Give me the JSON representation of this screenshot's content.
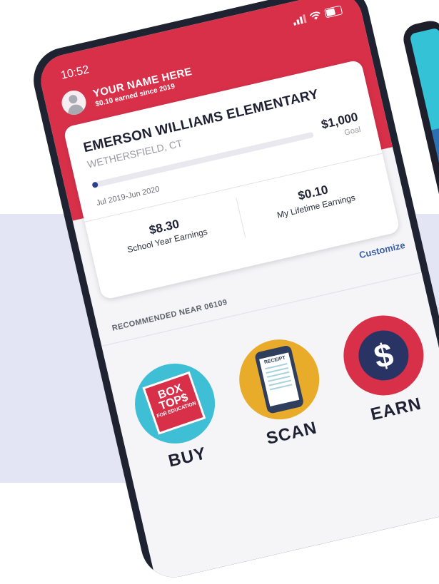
{
  "status_bar": {
    "time": "10:52"
  },
  "user": {
    "name": "YOUR NAME HERE",
    "subtitle": "$0.10 earned since 2019"
  },
  "school": {
    "name": "EMERSON WILLIAMS ELEMENTARY",
    "location": "WETHERSFIELD, CT",
    "goal_amount": "$1,000",
    "goal_label": "Goal",
    "progress_fraction": 0.01,
    "date_range": "Jul 2019-Jun 2020"
  },
  "stats": {
    "school_year": {
      "value": "$8.30",
      "label": "School Year Earnings"
    },
    "lifetime": {
      "value": "$0.10",
      "label": "My Lifetime Earnings"
    }
  },
  "customize_label": "Customize",
  "recommended_label": "RECOMMENDED NEAR 06109",
  "actions": {
    "buy": {
      "label": "BUY",
      "logo_lines": [
        "BOX",
        "TOP$",
        "FOR EDUCATION"
      ]
    },
    "scan": {
      "label": "SCAN",
      "receipt_text": "RECEIPT"
    },
    "earn": {
      "label": "EARN",
      "symbol": "$"
    }
  },
  "colors": {
    "header_red": "#d9304a",
    "progress_navy": "#2d3e8a",
    "buy_teal": "#3fbfd5",
    "scan_gold": "#e9ac2a",
    "earn_red": "#d9304a",
    "lavender_bg": "#e3e4f4"
  },
  "icons": [
    "signal-icon",
    "wifi-icon",
    "battery-icon",
    "avatar-icon",
    "receipt-icon",
    "dollar-icon"
  ]
}
